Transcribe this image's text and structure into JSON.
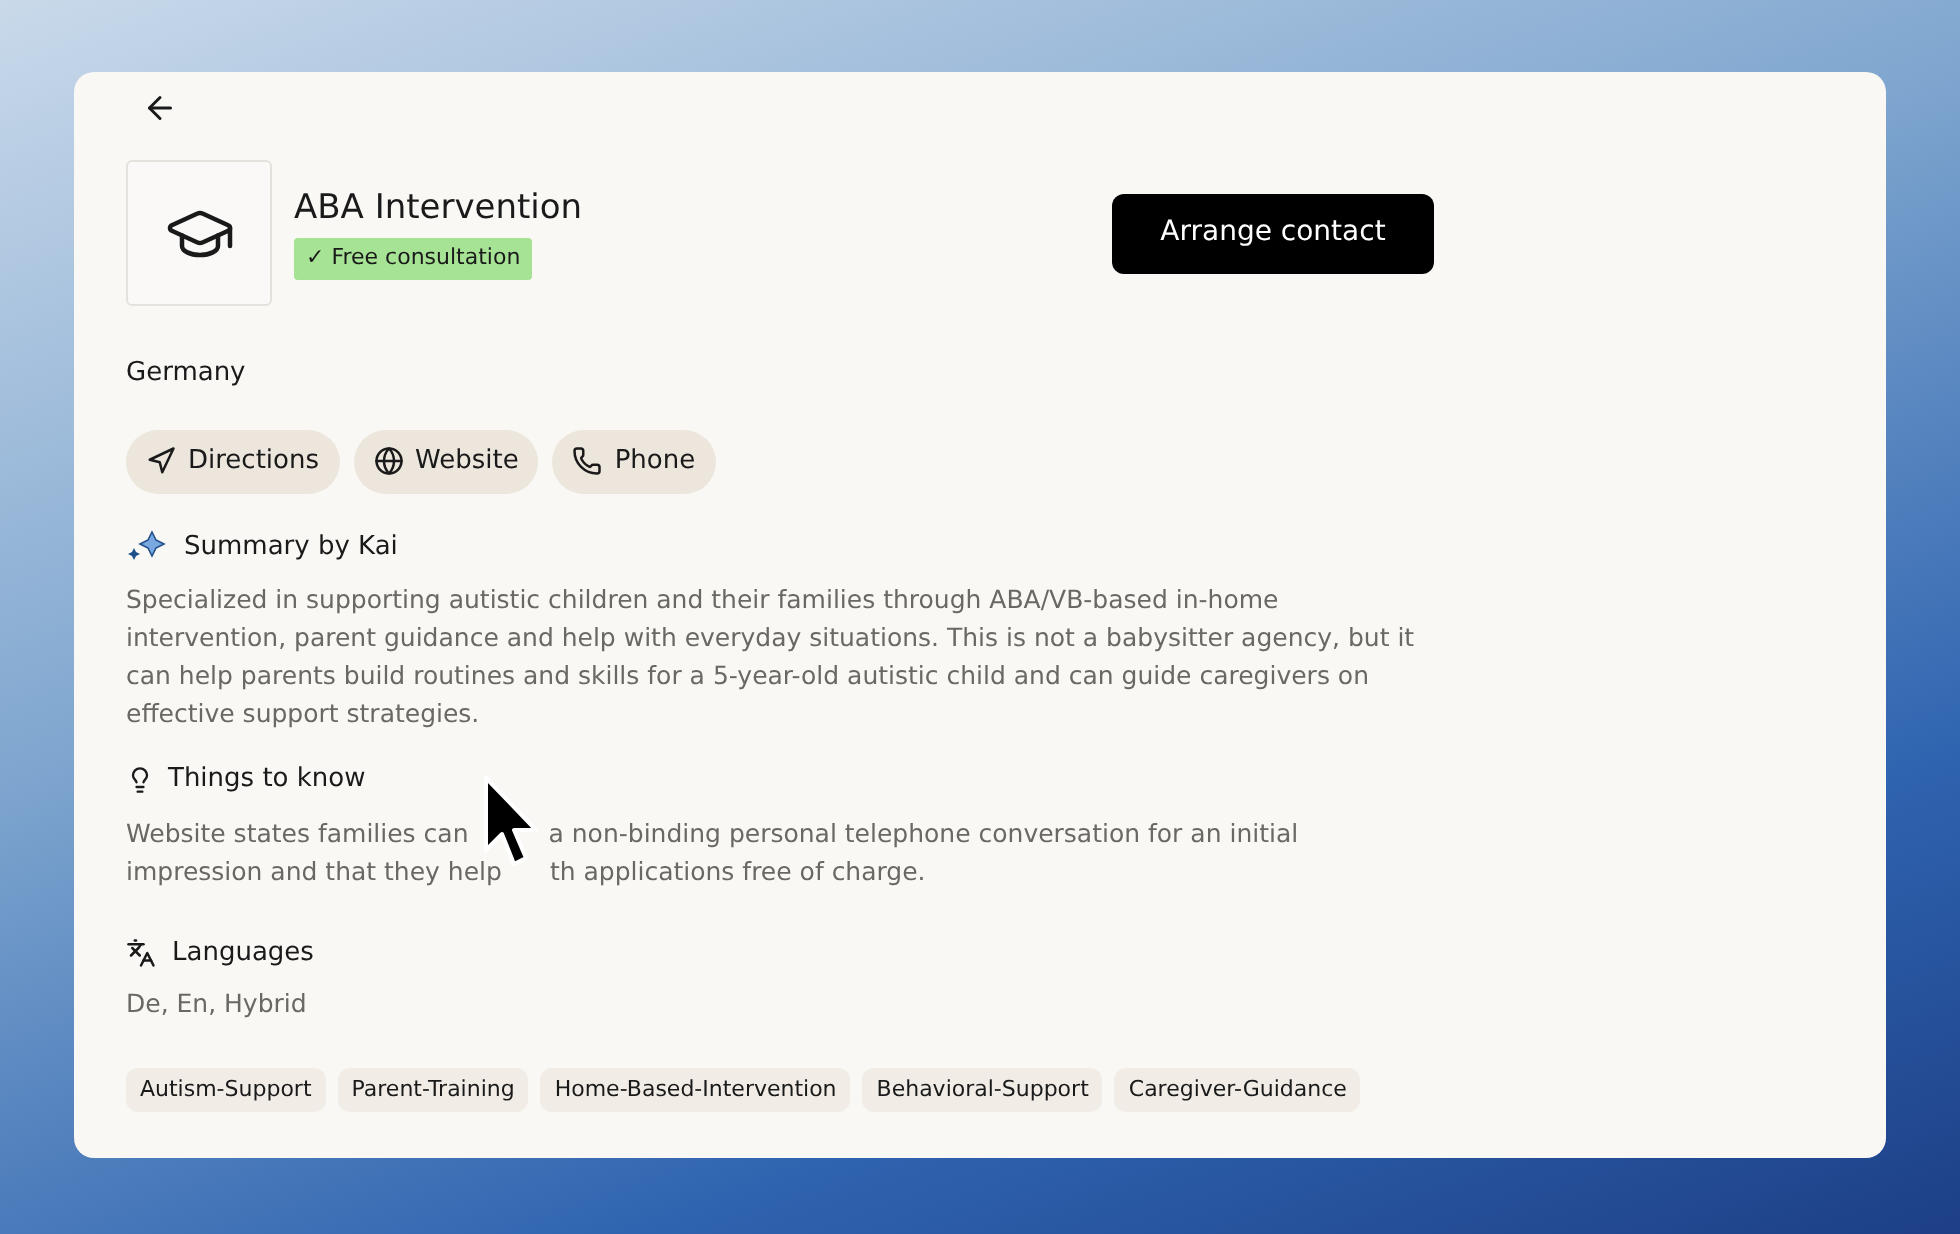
{
  "header": {
    "title": "ABA Intervention",
    "badge": "✓ Free consultation",
    "primary_button": "Arrange contact"
  },
  "location": "Germany",
  "actions": [
    {
      "kind": "directions",
      "label": "Directions"
    },
    {
      "kind": "website",
      "label": "Website"
    },
    {
      "kind": "phone",
      "label": "Phone"
    }
  ],
  "summary": {
    "heading": "Summary by Kai",
    "text": "Specialized in supporting autistic children and their families through ABA/VB-based in-home intervention, parent guidance and help with everyday situations. This is not a babysitter agency, but it can help parents build routines and skills for a 5-year-old autistic child and can guide caregivers on effective support strategies."
  },
  "things_to_know": {
    "heading": "Things to know",
    "lines": [
      [
        "Website states families can",
        "a non-binding personal telephone conversation for an initial"
      ],
      [
        "impression and that they help",
        "th applications free of charge."
      ]
    ]
  },
  "languages": {
    "heading": "Languages",
    "text": "De, En, Hybrid"
  },
  "tags": [
    "Autism-Support",
    "Parent-Training",
    "Home-Based-Intervention",
    "Behavioral-Support",
    "Caregiver-Guidance"
  ]
}
